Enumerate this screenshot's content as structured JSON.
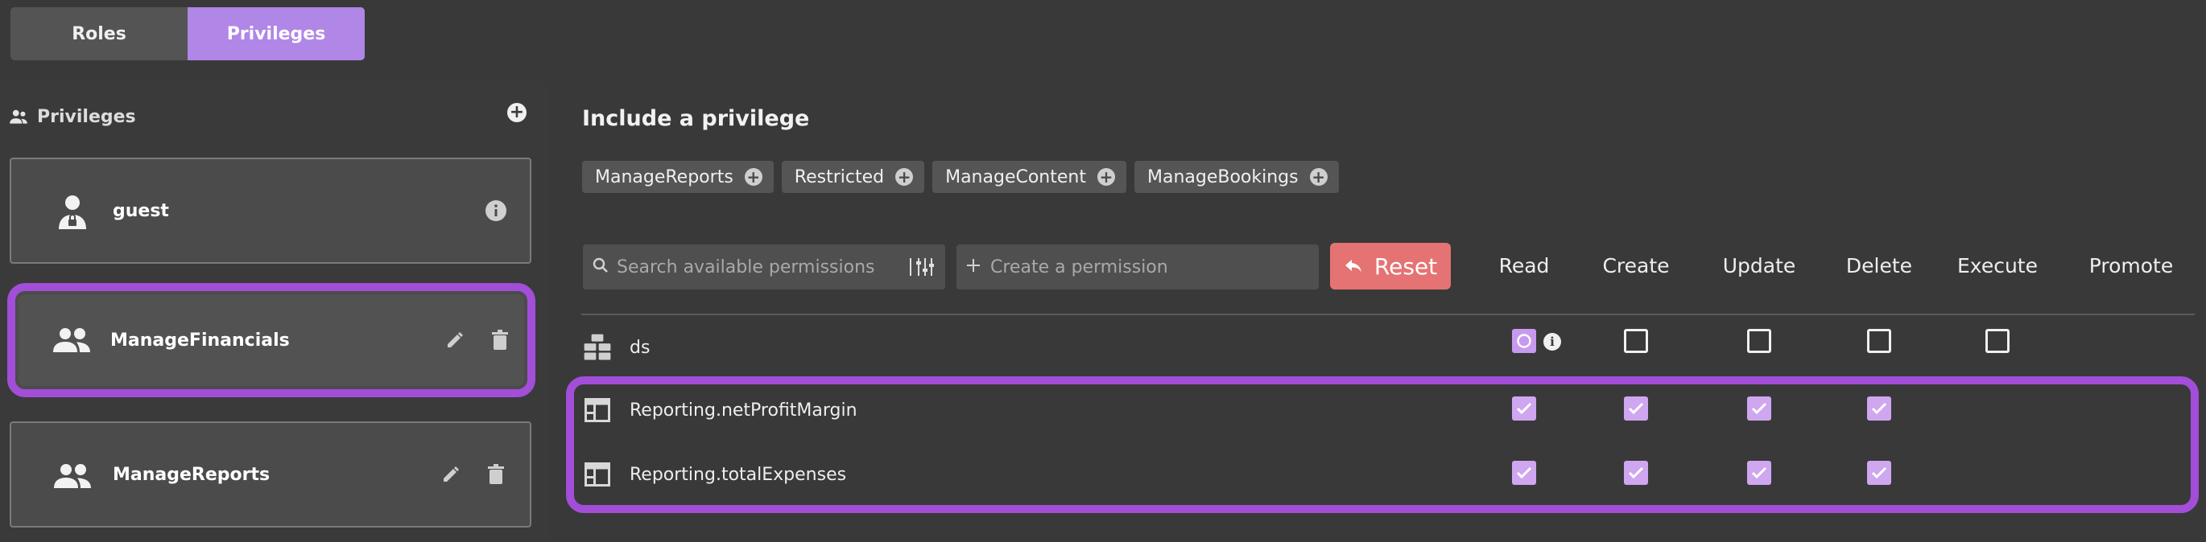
{
  "tabs": [
    {
      "label": "Roles",
      "active": false
    },
    {
      "label": "Privileges",
      "active": true
    }
  ],
  "sidebar": {
    "title": "Privileges",
    "items": [
      {
        "name": "guest",
        "icon": "guest-user-icon",
        "actions": [
          "info-icon"
        ]
      },
      {
        "name": "ManageFinancials",
        "icon": "users-group-icon",
        "selected": true,
        "actions": [
          "edit-icon",
          "delete-icon"
        ]
      },
      {
        "name": "ManageReports",
        "icon": "users-group-icon",
        "actions": [
          "edit-icon",
          "delete-icon"
        ]
      }
    ]
  },
  "main": {
    "title": "Include a privilege",
    "chips": [
      "ManageReports",
      "Restricted",
      "ManageContent",
      "ManageBookings"
    ],
    "search_placeholder": "Search available permissions",
    "create_placeholder": "Create a permission",
    "reset_label": "Reset",
    "columns": [
      "Read",
      "Create",
      "Update",
      "Delete",
      "Execute",
      "Promote"
    ],
    "rows": [
      {
        "label": "ds",
        "icon": "datasource-icon",
        "read": "partial",
        "create": "empty",
        "update": "empty",
        "delete": "empty",
        "execute": "empty"
      },
      {
        "label": "Reporting.netProfitMargin",
        "icon": "table-icon",
        "read": "checked",
        "create": "checked",
        "update": "checked",
        "delete": "checked"
      },
      {
        "label": "Reporting.totalExpenses",
        "icon": "table-icon",
        "read": "checked",
        "create": "checked",
        "update": "checked",
        "delete": "checked"
      }
    ]
  },
  "colors": {
    "accent": "#b086e6",
    "highlight": "#a24ed8",
    "reset": "#e57373",
    "checked": "#cfa6f0"
  }
}
